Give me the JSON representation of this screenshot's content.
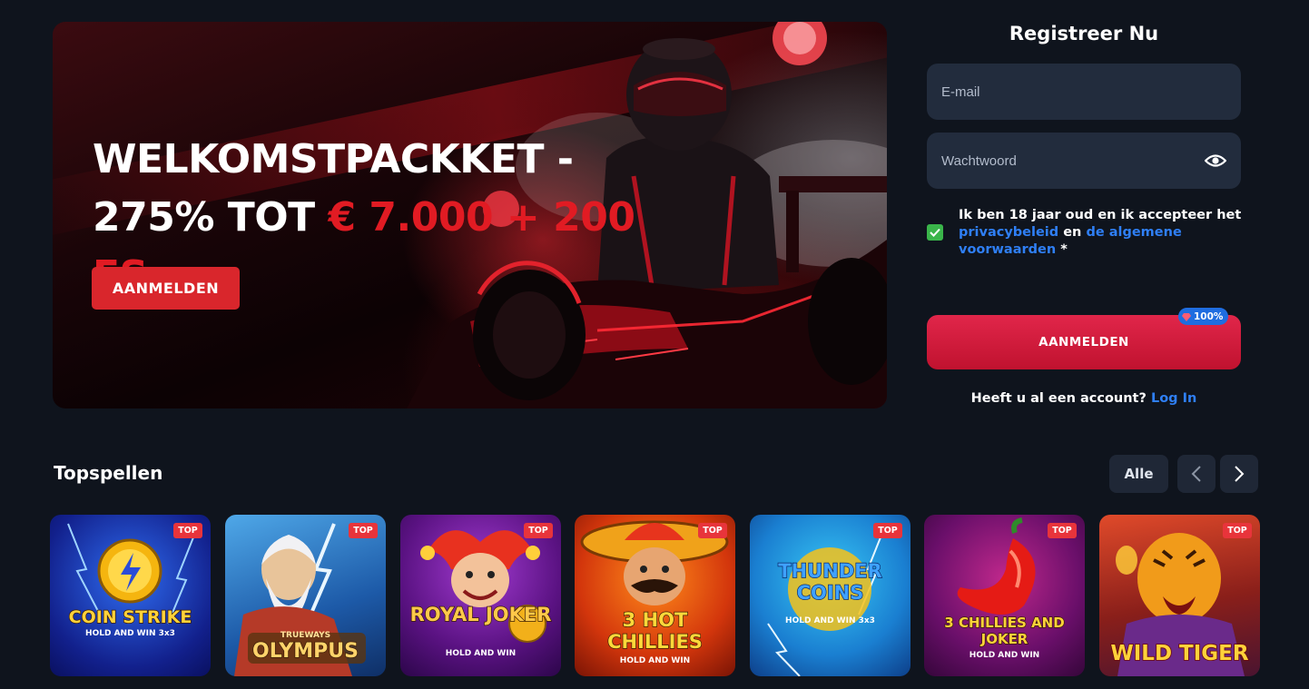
{
  "hero": {
    "title_line1": "WELKOMSTPACKKET -",
    "title_line2_prefix": "275% TOT ",
    "title_line2_highlight": "€ 7.000 + 200 FS",
    "cta_label": "AANMELDEN"
  },
  "register": {
    "title": "Registreer Nu",
    "email_placeholder": "E-mail",
    "password_placeholder": "Wachtwoord",
    "consent_text": "Ik ben 18 jaar oud en ik accepteer het",
    "privacy_link": "privacybeleid",
    "consent_and": "en",
    "terms_link": "de algemene voorwaarden",
    "required_mark": "*",
    "submit_label": "AANMELDEN",
    "bonus_badge": "100%",
    "login_prompt": "Heeft u al een account?",
    "login_link": "Log In"
  },
  "top_games": {
    "title": "Topspellen",
    "all_label": "Alle",
    "badge": "TOP",
    "items": [
      {
        "title": "COIN STRIKE",
        "subtitle": "HOLD AND WIN 3x3",
        "icon": "lightning-coin-icon"
      },
      {
        "title": "OLYMPUS",
        "subtitle": "TRUEWAYS",
        "icon": "zeus-icon"
      },
      {
        "title": "ROYAL JOKER",
        "subtitle": "HOLD AND WIN",
        "icon": "jester-icon"
      },
      {
        "title": "3 HOT CHILLIES",
        "subtitle": "HOLD AND WIN",
        "icon": "mexican-icon"
      },
      {
        "title": "THUNDER COINS",
        "subtitle": "HOLD AND WIN 3x3",
        "icon": "thunder-icon"
      },
      {
        "title": "3 CHILLIES AND JOKER",
        "subtitle": "HOLD AND WIN",
        "icon": "chili-icon"
      },
      {
        "title": "WILD TIGER",
        "subtitle": "",
        "icon": "tiger-icon"
      }
    ]
  },
  "colors": {
    "background": "#0f141d",
    "accent_red": "#d9262c",
    "link_blue": "#2f7ff5",
    "field_bg": "#222c3d",
    "check_green": "#3ab54a"
  }
}
